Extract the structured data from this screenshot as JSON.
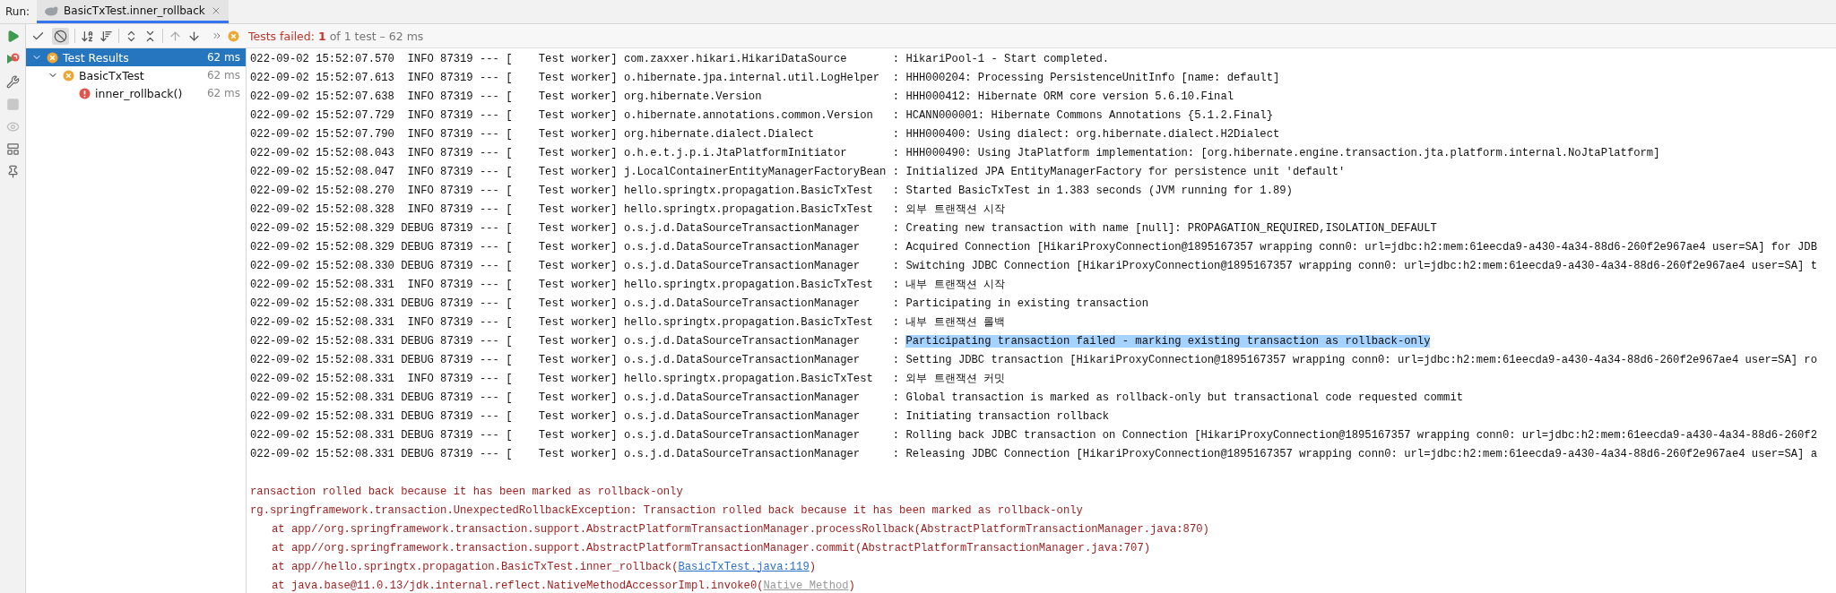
{
  "run_label": "Run:",
  "tab": {
    "title": "BasicTxTest.inner_rollback",
    "selected": true
  },
  "toolbar_toggles": [
    {
      "pressed": false
    },
    {
      "pressed": true
    }
  ],
  "status": {
    "label": "Tests failed:",
    "count": "1",
    "detail": "of 1 test – 62 ms"
  },
  "tree": [
    {
      "label": "Test Results",
      "time": "62 ms",
      "kind": "failed",
      "selected": true,
      "expanded": true,
      "children": [
        {
          "label": "BasicTxTest",
          "time": "62 ms",
          "kind": "failed",
          "selected": false,
          "expanded": true,
          "children": [
            {
              "label": "inner_rollback()",
              "time": "62 ms",
              "kind": "error",
              "selected": false
            }
          ]
        }
      ]
    }
  ],
  "log": [
    {
      "source": "022-09-02 15:52:07.570  INFO 87319 --- [    Test worker] com.zaxxer.hikari.HikariDataSource       :",
      "message": "HikariPool-1 - Start completed.",
      "highlighted": false
    },
    {
      "source": "022-09-02 15:52:07.613  INFO 87319 --- [    Test worker] o.hibernate.jpa.internal.util.LogHelper  :",
      "message": "HHH000204: Processing PersistenceUnitInfo [name: default]",
      "highlighted": false
    },
    {
      "source": "022-09-02 15:52:07.638  INFO 87319 --- [    Test worker] org.hibernate.Version                    :",
      "message": "HHH000412: Hibernate ORM core version 5.6.10.Final",
      "highlighted": false
    },
    {
      "source": "022-09-02 15:52:07.729  INFO 87319 --- [    Test worker] o.hibernate.annotations.common.Version   :",
      "message": "HCANN000001: Hibernate Commons Annotations {5.1.2.Final}",
      "highlighted": false
    },
    {
      "source": "022-09-02 15:52:07.790  INFO 87319 --- [    Test worker] org.hibernate.dialect.Dialect            :",
      "message": "HHH000400: Using dialect: org.hibernate.dialect.H2Dialect",
      "highlighted": false
    },
    {
      "source": "022-09-02 15:52:08.043  INFO 87319 --- [    Test worker] o.h.e.t.j.p.i.JtaPlatformInitiator       :",
      "message": "HHH000490: Using JtaPlatform implementation: [org.hibernate.engine.transaction.jta.platform.internal.NoJtaPlatform]",
      "highlighted": false
    },
    {
      "source": "022-09-02 15:52:08.047  INFO 87319 --- [    Test worker] j.LocalContainerEntityManagerFactoryBean :",
      "message": "Initialized JPA EntityManagerFactory for persistence unit 'default'",
      "highlighted": false
    },
    {
      "source": "022-09-02 15:52:08.270  INFO 87319 --- [    Test worker] hello.springtx.propagation.BasicTxTest   :",
      "message": "Started BasicTxTest in 1.383 seconds (JVM running for 1.89)",
      "highlighted": false
    },
    {
      "source": "022-09-02 15:52:08.328  INFO 87319 --- [    Test worker] hello.springtx.propagation.BasicTxTest   :",
      "message": "외부 트랜잭션 시작",
      "highlighted": false
    },
    {
      "source": "022-09-02 15:52:08.329 DEBUG 87319 --- [    Test worker] o.s.j.d.DataSourceTransactionManager     :",
      "message": "Creating new transaction with name [null]: PROPAGATION_REQUIRED,ISOLATION_DEFAULT",
      "highlighted": false
    },
    {
      "source": "022-09-02 15:52:08.329 DEBUG 87319 --- [    Test worker] o.s.j.d.DataSourceTransactionManager     :",
      "message": "Acquired Connection [HikariProxyConnection@1895167357 wrapping conn0: url=jdbc:h2:mem:61eecda9-a430-4a34-88d6-260f2e967ae4 user=SA] for JDB",
      "highlighted": false
    },
    {
      "source": "022-09-02 15:52:08.330 DEBUG 87319 --- [    Test worker] o.s.j.d.DataSourceTransactionManager     :",
      "message": "Switching JDBC Connection [HikariProxyConnection@1895167357 wrapping conn0: url=jdbc:h2:mem:61eecda9-a430-4a34-88d6-260f2e967ae4 user=SA] t",
      "highlighted": false
    },
    {
      "source": "022-09-02 15:52:08.331  INFO 87319 --- [    Test worker] hello.springtx.propagation.BasicTxTest   :",
      "message": "내부 트랜잭션 시작",
      "highlighted": false
    },
    {
      "source": "022-09-02 15:52:08.331 DEBUG 87319 --- [    Test worker] o.s.j.d.DataSourceTransactionManager     :",
      "message": "Participating in existing transaction",
      "highlighted": false
    },
    {
      "source": "022-09-02 15:52:08.331  INFO 87319 --- [    Test worker] hello.springtx.propagation.BasicTxTest   :",
      "message": "내부 트랜잭션 롤백",
      "highlighted": false
    },
    {
      "source": "022-09-02 15:52:08.331 DEBUG 87319 --- [    Test worker] o.s.j.d.DataSourceTransactionManager     :",
      "message": "Participating transaction failed - marking existing transaction as rollback-only",
      "highlighted": true
    },
    {
      "source": "022-09-02 15:52:08.331 DEBUG 87319 --- [    Test worker] o.s.j.d.DataSourceTransactionManager     :",
      "message": "Setting JDBC transaction [HikariProxyConnection@1895167357 wrapping conn0: url=jdbc:h2:mem:61eecda9-a430-4a34-88d6-260f2e967ae4 user=SA] ro",
      "highlighted": false
    },
    {
      "source": "022-09-02 15:52:08.331  INFO 87319 --- [    Test worker] hello.springtx.propagation.BasicTxTest   :",
      "message": "외부 트랜잭션 커밋",
      "highlighted": false
    },
    {
      "source": "022-09-02 15:52:08.331 DEBUG 87319 --- [    Test worker] o.s.j.d.DataSourceTransactionManager     :",
      "message": "Global transaction is marked as rollback-only but transactional code requested commit",
      "highlighted": false
    },
    {
      "source": "022-09-02 15:52:08.331 DEBUG 87319 --- [    Test worker] o.s.j.d.DataSourceTransactionManager     :",
      "message": "Initiating transaction rollback",
      "highlighted": false
    },
    {
      "source": "022-09-02 15:52:08.331 DEBUG 87319 --- [    Test worker] o.s.j.d.DataSourceTransactionManager     :",
      "message": "Rolling back JDBC transaction on Connection [HikariProxyConnection@1895167357 wrapping conn0: url=jdbc:h2:mem:61eecda9-a430-4a34-88d6-260f2",
      "highlighted": false
    },
    {
      "source": "022-09-02 15:52:08.331 DEBUG 87319 --- [    Test worker] o.s.j.d.DataSourceTransactionManager     :",
      "message": "Releasing JDBC Connection [HikariProxyConnection@1895167357 wrapping conn0: url=jdbc:h2:mem:61eecda9-a430-4a34-88d6-260f2e967ae4 user=SA] a",
      "highlighted": false
    }
  ],
  "error": [
    {
      "kind": "message",
      "text": "ransaction rolled back because it has been marked as rollback-only"
    },
    {
      "kind": "exception",
      "text": "rg.springframework.transaction.UnexpectedRollbackException: Transaction rolled back because it has been marked as rollback-only"
    },
    {
      "kind": "frame",
      "text": "at app//org.springframework.transaction.support.AbstractPlatformTransactionManager.processRollback(AbstractPlatformTransactionManager.java:870)"
    },
    {
      "kind": "frame",
      "text": "at app//org.springframework.transaction.support.AbstractPlatformTransactionManager.commit(AbstractPlatformTransactionManager.java:707)"
    },
    {
      "kind": "frame",
      "text": "at app//hello.springtx.propagation.BasicTxTest.inner_rollback(",
      "link": {
        "text": "BasicTxTest.java:119",
        "kind": "source"
      },
      "suffix": ")"
    },
    {
      "kind": "frame",
      "text": "at java.base@11.0.13/jdk.internal.reflect.NativeMethodAccessorImpl.invoke0(",
      "link": {
        "text": "Native Method",
        "kind": "native"
      },
      "suffix": ")"
    }
  ]
}
